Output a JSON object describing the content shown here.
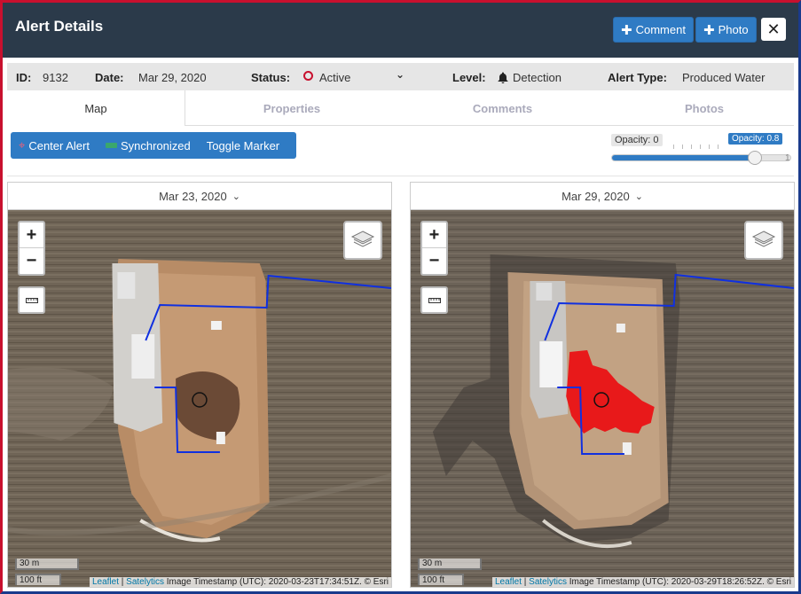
{
  "header": {
    "title": "Alert Details",
    "comment_button": "Comment",
    "photo_button": "Photo",
    "close_glyph": "✕"
  },
  "info": {
    "id_label": "ID:",
    "id_value": "9132",
    "date_label": "Date:",
    "date_value": "Mar 29, 2020",
    "status_label": "Status:",
    "status_value": "Active",
    "level_label": "Level:",
    "level_value": "Detection",
    "type_label": "Alert Type:",
    "type_value": "Produced Water"
  },
  "tabs": [
    {
      "label": "Map",
      "active": true
    },
    {
      "label": "Properties",
      "active": false
    },
    {
      "label": "Comments",
      "active": false
    },
    {
      "label": "Photos",
      "active": false
    }
  ],
  "toolbar": {
    "center_alert": "Center Alert",
    "synchronized": "Synchronized",
    "toggle_marker": "Toggle Marker"
  },
  "opacity": {
    "min_label": "Opacity: 0",
    "current_label": "Opacity: 0.8",
    "max_label": "1",
    "value": 0.8
  },
  "maps": [
    {
      "date": "Mar 23, 2020",
      "scale_m": "30 m",
      "scale_ft": "100 ft",
      "attr_leaflet": "Leaflet",
      "attr_sep": "|",
      "attr_satelytics": "Satelytics",
      "attr_text": "Image Timestamp (UTC): 2020-03-23T17:34:51Z. © Esri"
    },
    {
      "date": "Mar 29, 2020",
      "scale_m": "30 m",
      "scale_ft": "100 ft",
      "attr_leaflet": "Leaflet",
      "attr_sep": "|",
      "attr_satelytics": "Satelytics",
      "attr_text": "Image Timestamp (UTC): 2020-03-29T18:26:52Z. © Esri"
    }
  ],
  "colors": {
    "header_bg": "#2b3a4a",
    "primary": "#2f7bc4",
    "status_active": "#c8102e",
    "alert_overlay": "#e8191a",
    "pipeline": "#1030e0"
  },
  "icons": {
    "add": "plus-icon",
    "close": "close-icon",
    "status": "circle-icon",
    "level": "bell-icon",
    "center": "crosshair-icon",
    "sync": "sync-bar-icon",
    "layers": "layers-icon",
    "measure": "ruler-icon",
    "date_dropdown": "chevron-down-icon"
  }
}
